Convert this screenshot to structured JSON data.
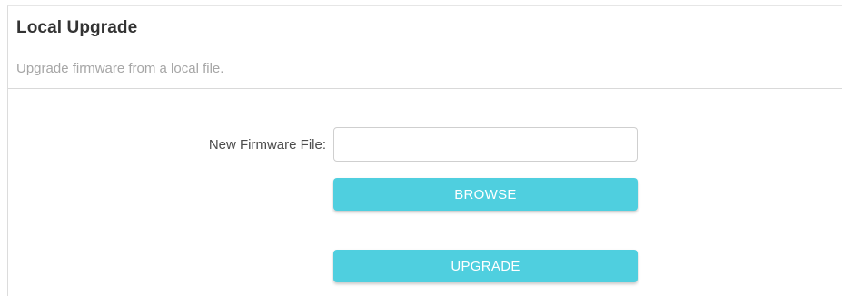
{
  "section": {
    "title": "Local Upgrade",
    "description": "Upgrade firmware from a local file."
  },
  "form": {
    "file_label": "New Firmware File:",
    "file_value": "",
    "browse_label": "BROWSE",
    "upgrade_label": "UPGRADE"
  },
  "colors": {
    "button_background": "#4fcfdf",
    "button_text": "#ffffff",
    "title_text": "#333333",
    "description_text": "#a6a6a6"
  }
}
